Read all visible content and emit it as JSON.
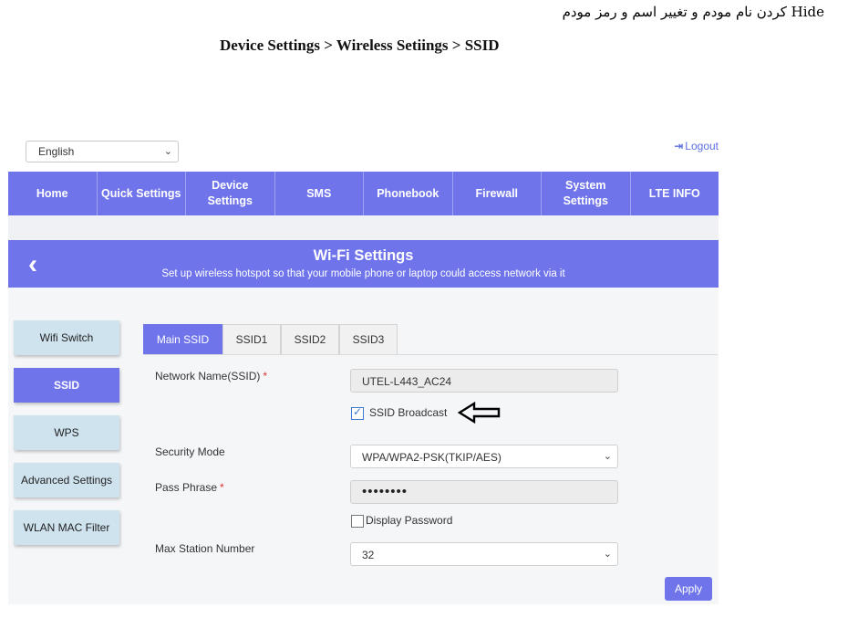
{
  "doc": {
    "caption": "Hide کردن نام مودم  و تغییر اسم و رمز مودم",
    "heading": "Device Settings > Wireless Setiings > SSID"
  },
  "topbar": {
    "language": "English",
    "logout": "Logout",
    "logout_icon": "logout-icon"
  },
  "nav": {
    "items": [
      "Home",
      "Quick Settings",
      "Device Settings",
      "SMS",
      "Phonebook",
      "Firewall",
      "System\nSettings",
      "LTE INFO"
    ]
  },
  "banner": {
    "title": "Wi-Fi Settings",
    "subtitle": "Set up wireless hotspot so that your mobile phone or laptop could access network via it",
    "back_icon": "chevron-left-icon"
  },
  "sidebar": {
    "items": [
      "Wifi Switch",
      "SSID",
      "WPS",
      "Advanced Settings",
      "WLAN MAC Filter"
    ],
    "active": "SSID"
  },
  "tabs": {
    "items": [
      "Main SSID",
      "SSID1",
      "SSID2",
      "SSID3"
    ],
    "active": "Main SSID"
  },
  "form": {
    "network_name_label": "Network Name(SSID)",
    "network_name_value": "UTEL-L443_AC24",
    "ssid_broadcast_label": "SSID Broadcast",
    "ssid_broadcast_checked": true,
    "security_mode_label": "Security Mode",
    "security_mode_value": "WPA/WPA2-PSK(TKIP/AES)",
    "pass_phrase_label": "Pass Phrase",
    "pass_phrase_value": "••••••••",
    "display_password_label": "Display Password",
    "display_password_checked": false,
    "max_station_label": "Max Station Number",
    "max_station_value": "32",
    "required_mark": "*",
    "apply_label": "Apply"
  },
  "colors": {
    "accent": "#6f74ea",
    "sidebar_inactive": "#cfe3ef",
    "page_bg": "#f5f6f8"
  }
}
